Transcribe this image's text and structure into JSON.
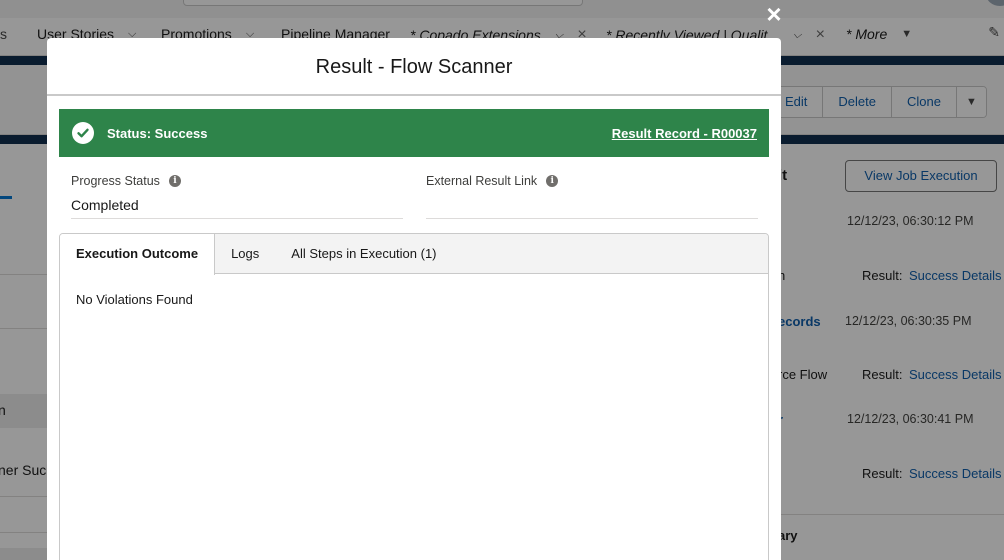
{
  "nav": {
    "items": [
      {
        "label": "User Stories",
        "italic": false
      },
      {
        "label": "Promotions",
        "italic": false
      },
      {
        "label": "Pipeline Manager",
        "italic": false
      },
      {
        "label": "* Copado Extensions",
        "italic": true
      },
      {
        "label": "* Recently Viewed | Qualit...",
        "italic": true
      },
      {
        "label": "* More",
        "italic": true
      }
    ]
  },
  "record_actions": {
    "edit": "Edit",
    "delete": "Delete",
    "clone": "Clone"
  },
  "left_fragments": {
    "row1": "n",
    "row2": "ner Suc"
  },
  "right_panel": {
    "heading_fragment": "it",
    "view_job_execution": "View Job Execution",
    "entries": [
      {
        "title": "",
        "date": "12/12/23, 06:30:12 PM",
        "detail": "n",
        "result_label": "Result:",
        "result_link": "Success Details"
      },
      {
        "title": "ecords",
        "date": "12/12/23, 06:30:35 PM",
        "detail": "rce Flow",
        "result_label": "Result:",
        "result_link": "Success Details"
      },
      {
        "title": "r",
        "date": "12/12/23, 06:30:41 PM",
        "detail": "",
        "result_label": "Result:",
        "result_link": "Success Details"
      }
    ],
    "summary_fragment": "ary"
  },
  "modal": {
    "title": "Result - Flow Scanner",
    "close_label": "×",
    "status_text": "Status: Success",
    "record_link": "Result Record - R00037",
    "fields": {
      "progress_status_label": "Progress Status",
      "progress_status_value": "Completed",
      "external_link_label": "External Result Link",
      "external_link_value": ""
    },
    "tabs": [
      {
        "label": "Execution Outcome",
        "active": true
      },
      {
        "label": "Logs",
        "active": false
      },
      {
        "label": "All Steps in Execution (1)",
        "active": false
      }
    ],
    "content": "No Violations Found"
  },
  "colors": {
    "success_green": "#2e844a",
    "brand_navy": "#0d2c4d",
    "link_blue": "#0b5cab"
  },
  "icons": {
    "status": "check-circle-icon",
    "info": "info-icon",
    "close": "close-icon"
  }
}
